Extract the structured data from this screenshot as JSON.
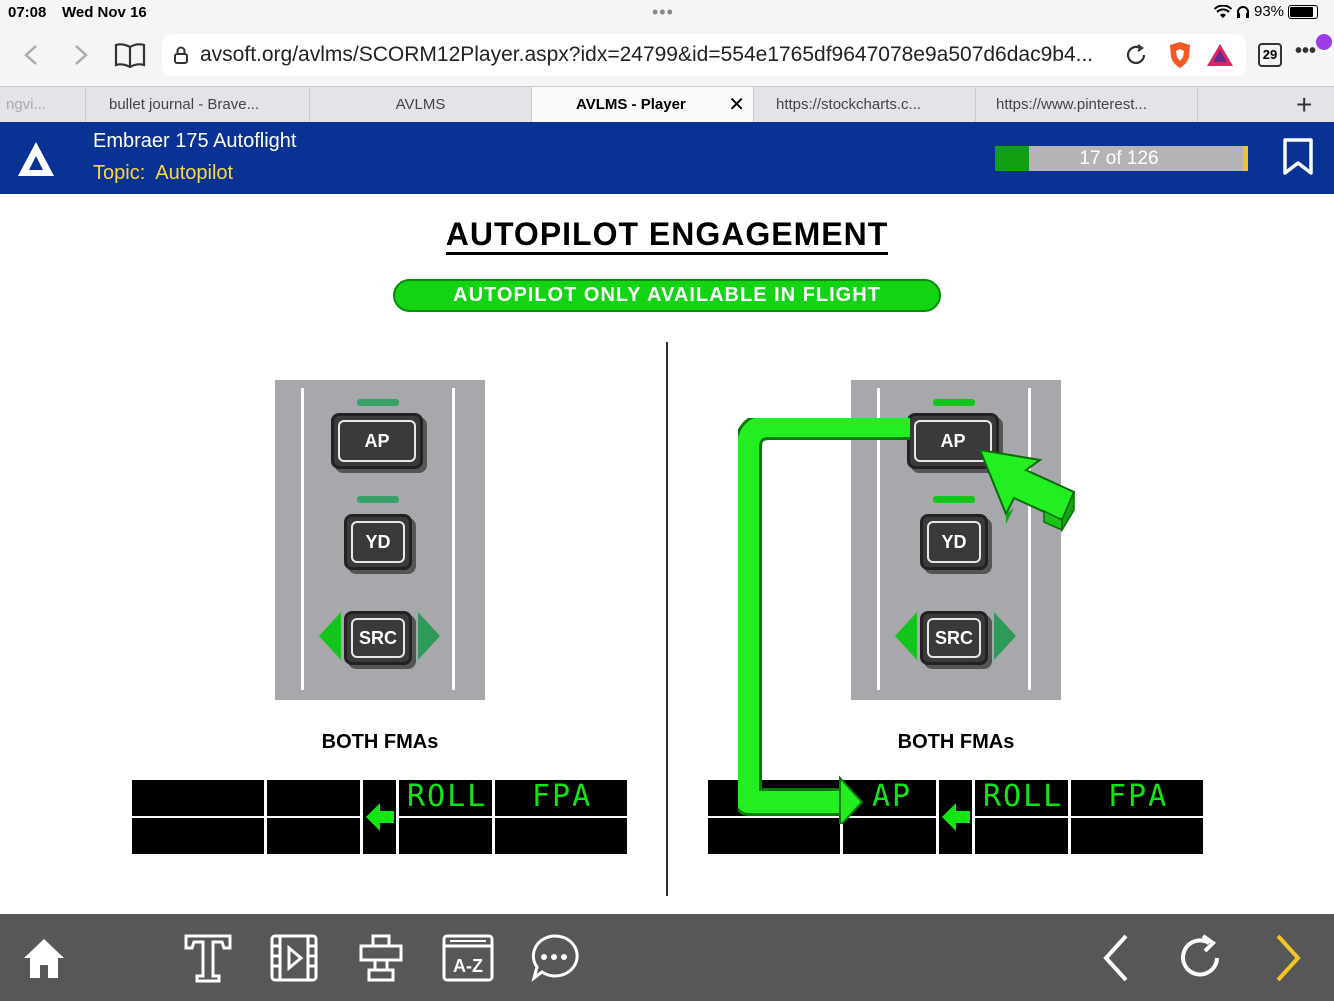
{
  "status_bar": {
    "time": "07:08",
    "date": "Wed Nov 16",
    "more": "•••",
    "battery": "93%"
  },
  "browser": {
    "url": "avsoft.org/avlms/SCORM12Player.aspx?idx=24799&id=554e1765df9647078e9a507d6dac9b4...",
    "tab_count": "29",
    "tabs": [
      {
        "label": "ngvi..."
      },
      {
        "label": "bullet journal - Brave..."
      },
      {
        "label": "AVLMS"
      },
      {
        "label": "AVLMS - Player",
        "active": true
      },
      {
        "label": "https://stockcharts.c..."
      },
      {
        "label": "https://www.pinterest..."
      }
    ]
  },
  "header": {
    "course_title": "Embraer 175 Autoflight",
    "topic_label": "Topic:",
    "topic_value": "Autopilot",
    "progress_text": "17 of 126",
    "progress_current": 17,
    "progress_total": 126
  },
  "slide": {
    "title": "AUTOPILOT ENGAGEMENT",
    "banner": "AUTOPILOT ONLY AVAILABLE IN FLIGHT",
    "left": {
      "buttons": {
        "ap": "AP",
        "yd": "YD",
        "src": "SRC"
      },
      "fma_label": "BOTH FMAs",
      "fma": {
        "col3": "",
        "col4": "ROLL",
        "col5": "FPA"
      }
    },
    "right": {
      "buttons": {
        "ap": "AP",
        "yd": "YD",
        "src": "SRC"
      },
      "fma_label": "BOTH FMAs",
      "fma": {
        "col2": "AP",
        "col4": "ROLL",
        "col5": "FPA"
      }
    }
  },
  "colors": {
    "header_blue": "#0a3294",
    "topic_yellow": "#ffd83a",
    "fma_green": "#12e612",
    "progress_green": "#11a011",
    "toolbar_gray": "#575759"
  },
  "bottom_toolbar": {
    "icons": [
      "home-icon",
      "text-icon",
      "video-icon",
      "sign-icon",
      "glossary-icon",
      "chat-icon",
      "back-arrow-icon",
      "replay-icon",
      "next-arrow-icon"
    ],
    "glossary_label": "A-Z"
  }
}
